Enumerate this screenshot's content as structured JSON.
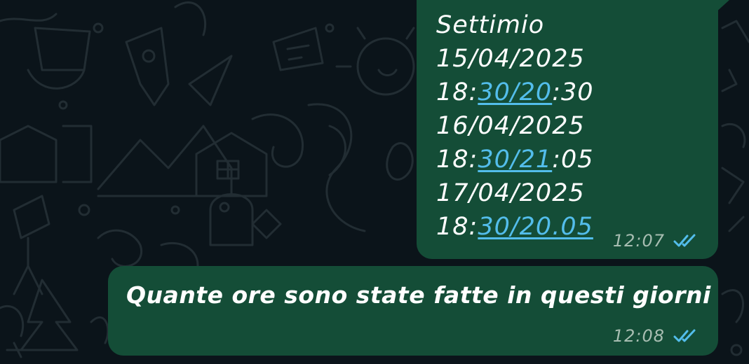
{
  "chat": {
    "messages": [
      {
        "lines": [
          {
            "plain": "Settimio"
          },
          {
            "plain": "15/04/2025"
          },
          {
            "prefix": "18:",
            "link": "30/20",
            "suffix": ":30"
          },
          {
            "plain": "16/04/2025"
          },
          {
            "prefix": "18:",
            "link": "30/21",
            "suffix": ":05"
          },
          {
            "plain": "17/04/2025"
          },
          {
            "prefix": "18:",
            "link": "30/20.05",
            "suffix": ""
          }
        ],
        "time": "12:07",
        "status_icon": "double-check-read-icon"
      },
      {
        "text": "Quante ore sono state fatte in questi giorni",
        "time": "12:08",
        "status_icon": "double-check-read-icon"
      }
    ]
  },
  "colors": {
    "background": "#0b141a",
    "bubble": "#144d37",
    "link": "#53bdeb",
    "meta": "#a7bdb1"
  }
}
